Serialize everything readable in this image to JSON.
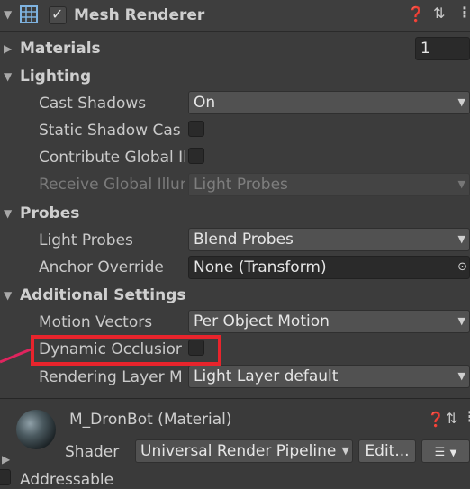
{
  "component": {
    "title": "Mesh Renderer",
    "enabled_check": "✓"
  },
  "materials": {
    "label": "Materials",
    "count": "1"
  },
  "lighting": {
    "label": "Lighting",
    "cast_shadows": {
      "label": "Cast Shadows",
      "value": "On"
    },
    "static_shadow": {
      "label": "Static Shadow Cas"
    },
    "contribute_gi": {
      "label": "Contribute Global Il"
    },
    "receive_gi": {
      "label": "Receive Global Illur",
      "value": "Light Probes"
    }
  },
  "probes": {
    "label": "Probes",
    "light_probes": {
      "label": "Light Probes",
      "value": "Blend Probes"
    },
    "anchor_override": {
      "label": "Anchor Override",
      "value": "None (Transform)"
    }
  },
  "additional": {
    "label": "Additional Settings",
    "motion_vectors": {
      "label": "Motion Vectors",
      "value": "Per Object Motion"
    },
    "dynamic_occlusion": {
      "label": "Dynamic Occlusior"
    },
    "rendering_layer": {
      "label": "Rendering Layer M",
      "value": "Light Layer default"
    }
  },
  "material_header": {
    "name": "M_DronBot (Material)",
    "shader_label": "Shader",
    "shader_value": "Universal Render Pipeline",
    "edit_label": "Edit...",
    "addressable_label": "Addressable"
  },
  "colors": {
    "highlight_box": "#e8242c",
    "annotation_line": "#e0245e"
  }
}
